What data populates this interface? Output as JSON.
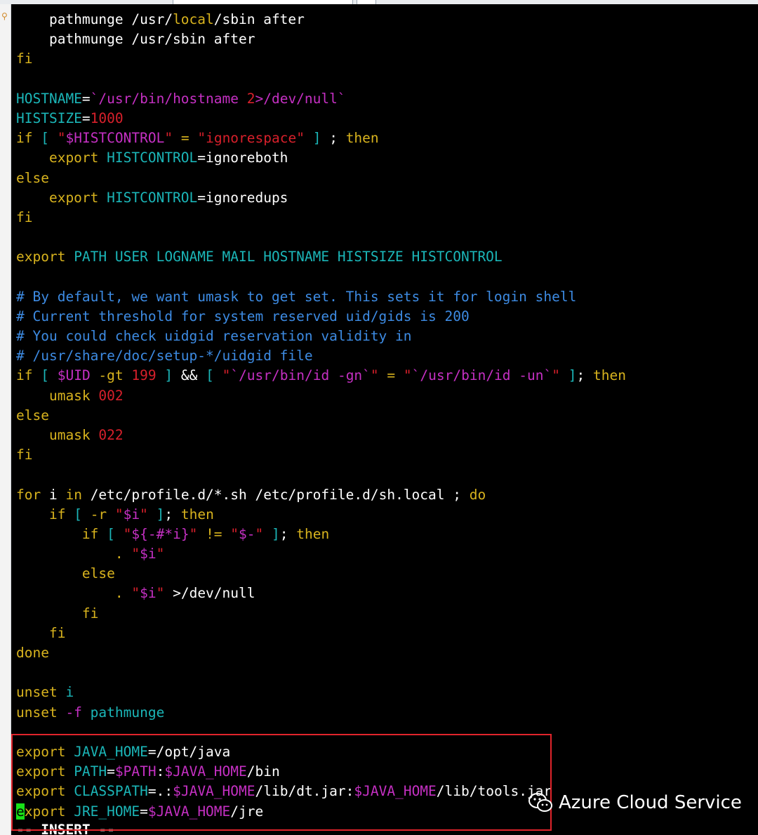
{
  "editor": {
    "mode": "-- INSERT --",
    "lines": [
      [
        {
          "t": "    pathmunge /usr/",
          "c": "w"
        },
        {
          "t": "local",
          "c": "y"
        },
        {
          "t": "/sbin after",
          "c": "w"
        }
      ],
      [
        {
          "t": "    pathmunge /usr/sbin after",
          "c": "w"
        }
      ],
      [
        {
          "t": "fi",
          "c": "y"
        }
      ],
      [],
      [
        {
          "t": "HOSTNAME",
          "c": "c"
        },
        {
          "t": "=",
          "c": "w"
        },
        {
          "t": "`/usr/bin/hostname ",
          "c": "m"
        },
        {
          "t": "2",
          "c": "r"
        },
        {
          "t": ">/dev/null`",
          "c": "m"
        }
      ],
      [
        {
          "t": "HISTSIZE",
          "c": "c"
        },
        {
          "t": "=",
          "c": "w"
        },
        {
          "t": "1000",
          "c": "r"
        }
      ],
      [
        {
          "t": "if",
          "c": "y"
        },
        {
          "t": " [ ",
          "c": "c"
        },
        {
          "t": "\"",
          "c": "r"
        },
        {
          "t": "$HISTCONTROL",
          "c": "m"
        },
        {
          "t": "\"",
          "c": "r"
        },
        {
          "t": " = ",
          "c": "y"
        },
        {
          "t": "\"ignorespace\"",
          "c": "r"
        },
        {
          "t": " ] ",
          "c": "c"
        },
        {
          "t": ";",
          "c": "w"
        },
        {
          "t": " then",
          "c": "y"
        }
      ],
      [
        {
          "t": "    export ",
          "c": "y"
        },
        {
          "t": "HISTCONTROL",
          "c": "c"
        },
        {
          "t": "=ignoreboth",
          "c": "w"
        }
      ],
      [
        {
          "t": "else",
          "c": "y"
        }
      ],
      [
        {
          "t": "    export ",
          "c": "y"
        },
        {
          "t": "HISTCONTROL",
          "c": "c"
        },
        {
          "t": "=ignoredups",
          "c": "w"
        }
      ],
      [
        {
          "t": "fi",
          "c": "y"
        }
      ],
      [],
      [
        {
          "t": "export ",
          "c": "y"
        },
        {
          "t": "PATH USER LOGNAME MAIL HOSTNAME HISTSIZE HISTCONTROL",
          "c": "c"
        }
      ],
      [],
      [
        {
          "t": "# By default, we want umask to get set. This sets it for login shell",
          "c": "b"
        }
      ],
      [
        {
          "t": "# Current threshold for system reserved uid/gids is 200",
          "c": "b"
        }
      ],
      [
        {
          "t": "# You could check uidgid reservation validity in",
          "c": "b"
        }
      ],
      [
        {
          "t": "# /usr/share/doc/setup-*/uidgid file",
          "c": "b"
        }
      ],
      [
        {
          "t": "if",
          "c": "y"
        },
        {
          "t": " [ ",
          "c": "c"
        },
        {
          "t": "$UID",
          "c": "m"
        },
        {
          "t": " -gt ",
          "c": "y"
        },
        {
          "t": "199",
          "c": "r"
        },
        {
          "t": " ] ",
          "c": "c"
        },
        {
          "t": "&&",
          "c": "w"
        },
        {
          "t": " [ ",
          "c": "c"
        },
        {
          "t": "\"",
          "c": "r"
        },
        {
          "t": "`/usr/bin/id -gn`",
          "c": "m"
        },
        {
          "t": "\"",
          "c": "r"
        },
        {
          "t": " = ",
          "c": "y"
        },
        {
          "t": "\"",
          "c": "r"
        },
        {
          "t": "`/usr/bin/id -un`",
          "c": "m"
        },
        {
          "t": "\"",
          "c": "r"
        },
        {
          "t": " ]",
          "c": "c"
        },
        {
          "t": "; ",
          "c": "w"
        },
        {
          "t": "then",
          "c": "y"
        }
      ],
      [
        {
          "t": "    umask ",
          "c": "y"
        },
        {
          "t": "002",
          "c": "r"
        }
      ],
      [
        {
          "t": "else",
          "c": "y"
        }
      ],
      [
        {
          "t": "    umask ",
          "c": "y"
        },
        {
          "t": "022",
          "c": "r"
        }
      ],
      [
        {
          "t": "fi",
          "c": "y"
        }
      ],
      [],
      [
        {
          "t": "for",
          "c": "y"
        },
        {
          "t": " i ",
          "c": "w"
        },
        {
          "t": "in",
          "c": "y"
        },
        {
          "t": " /etc/profile.d/*.sh /etc/profile.d/sh.local ",
          "c": "w"
        },
        {
          "t": ";",
          "c": "w"
        },
        {
          "t": " do",
          "c": "y"
        }
      ],
      [
        {
          "t": "    if",
          "c": "y"
        },
        {
          "t": " [ ",
          "c": "c"
        },
        {
          "t": "-r ",
          "c": "y"
        },
        {
          "t": "\"",
          "c": "r"
        },
        {
          "t": "$i",
          "c": "m"
        },
        {
          "t": "\"",
          "c": "r"
        },
        {
          "t": " ]",
          "c": "c"
        },
        {
          "t": "; ",
          "c": "w"
        },
        {
          "t": "then",
          "c": "y"
        }
      ],
      [
        {
          "t": "        if",
          "c": "y"
        },
        {
          "t": " [ ",
          "c": "c"
        },
        {
          "t": "\"",
          "c": "r"
        },
        {
          "t": "${-#*i}",
          "c": "m"
        },
        {
          "t": "\"",
          "c": "r"
        },
        {
          "t": " != ",
          "c": "y"
        },
        {
          "t": "\"",
          "c": "r"
        },
        {
          "t": "$-",
          "c": "m"
        },
        {
          "t": "\"",
          "c": "r"
        },
        {
          "t": " ]",
          "c": "c"
        },
        {
          "t": "; ",
          "c": "w"
        },
        {
          "t": "then",
          "c": "y"
        }
      ],
      [
        {
          "t": "            . ",
          "c": "y"
        },
        {
          "t": "\"",
          "c": "r"
        },
        {
          "t": "$i",
          "c": "m"
        },
        {
          "t": "\"",
          "c": "r"
        }
      ],
      [
        {
          "t": "        else",
          "c": "y"
        }
      ],
      [
        {
          "t": "            . ",
          "c": "y"
        },
        {
          "t": "\"",
          "c": "r"
        },
        {
          "t": "$i",
          "c": "m"
        },
        {
          "t": "\"",
          "c": "r"
        },
        {
          "t": " >/dev/null",
          "c": "w"
        }
      ],
      [
        {
          "t": "        fi",
          "c": "y"
        }
      ],
      [
        {
          "t": "    fi",
          "c": "y"
        }
      ],
      [
        {
          "t": "done",
          "c": "y"
        }
      ],
      [],
      [
        {
          "t": "unset",
          "c": "y"
        },
        {
          "t": " i",
          "c": "c"
        }
      ],
      [
        {
          "t": "unset",
          "c": "y"
        },
        {
          "t": " -f ",
          "c": "m"
        },
        {
          "t": "pathmunge",
          "c": "c"
        }
      ],
      [],
      [
        {
          "t": "export ",
          "c": "y"
        },
        {
          "t": "JAVA_HOME",
          "c": "c"
        },
        {
          "t": "=/opt/java",
          "c": "w"
        }
      ],
      [
        {
          "t": "export ",
          "c": "y"
        },
        {
          "t": "PATH",
          "c": "c"
        },
        {
          "t": "=",
          "c": "w"
        },
        {
          "t": "$PATH",
          "c": "m"
        },
        {
          "t": ":",
          "c": "w"
        },
        {
          "t": "$JAVA_HOME",
          "c": "m"
        },
        {
          "t": "/bin",
          "c": "w"
        }
      ],
      [
        {
          "t": "export ",
          "c": "y"
        },
        {
          "t": "CLASSPATH",
          "c": "c"
        },
        {
          "t": "=.:",
          "c": "w"
        },
        {
          "t": "$JAVA_HOME",
          "c": "m"
        },
        {
          "t": "/lib/dt.jar:",
          "c": "w"
        },
        {
          "t": "$JAVA_HOME",
          "c": "m"
        },
        {
          "t": "/lib/tools.jar",
          "c": "w"
        }
      ],
      [
        {
          "t": "e",
          "c": "cursor"
        },
        {
          "t": "xport ",
          "c": "y"
        },
        {
          "t": "JRE_HOME",
          "c": "c"
        },
        {
          "t": "=",
          "c": "w"
        },
        {
          "t": "$JAVA_HOME",
          "c": "m"
        },
        {
          "t": "/jre",
          "c": "w"
        }
      ]
    ]
  },
  "watermark": {
    "text": "Azure Cloud Service",
    "icon": "wechat-icon"
  },
  "colors": {
    "background": "#000000",
    "keyword": "#d8b31e",
    "identifier": "#1bb6b8",
    "variable": "#c530c3",
    "literal": "#d7202b",
    "comment": "#3d8be3",
    "cursor": "#18e018",
    "highlight_box": "#e0242b"
  }
}
